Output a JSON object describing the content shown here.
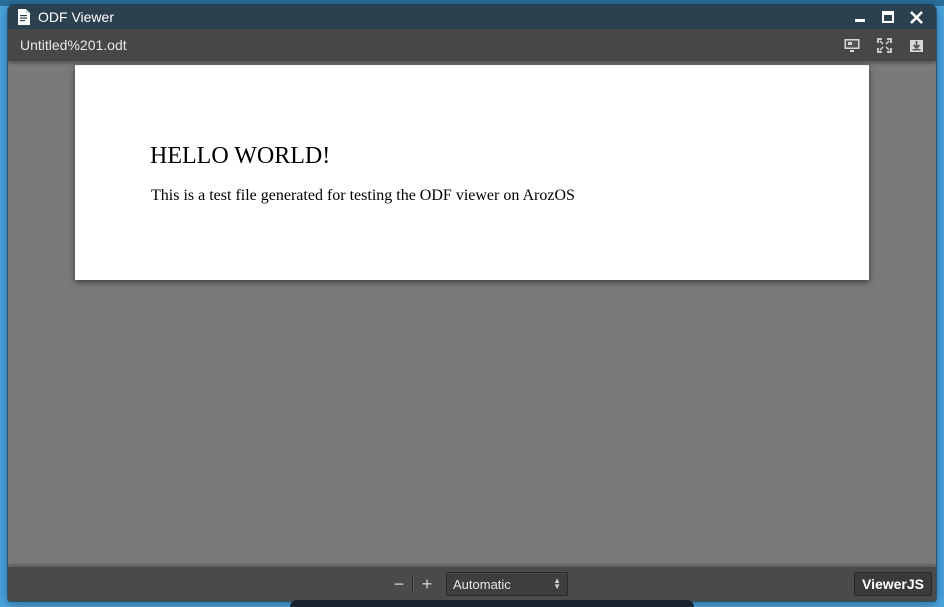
{
  "window": {
    "title": "ODF Viewer",
    "controls": {
      "minimize_icon": "minimize-icon",
      "maximize_icon": "maximize-icon",
      "close_icon": "close-icon"
    }
  },
  "toolbar": {
    "document_title": "Untitled%201.odt",
    "buttons": [
      "presentation-icon",
      "fullscreen-icon",
      "download-icon"
    ]
  },
  "document": {
    "heading": "HELLO WORLD!",
    "body": "This is a test file generated for testing the ODF viewer on ArozOS"
  },
  "bottom_toolbar": {
    "zoom_out": "−",
    "zoom_in": "+",
    "zoom_value": "Automatic",
    "brand_button": "ViewerJS"
  },
  "colors": {
    "titlebar": "#2b4150",
    "toolbar": "#474747",
    "canvas": "#7a7a7a",
    "desktop": "#4aa3dd"
  }
}
